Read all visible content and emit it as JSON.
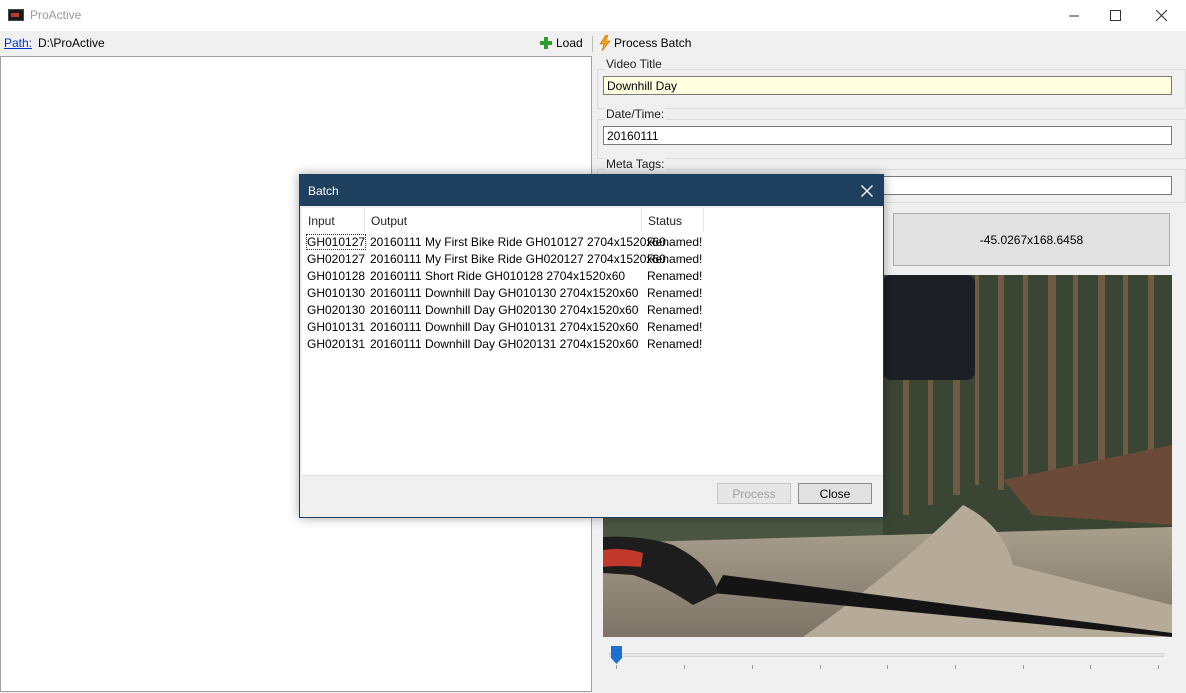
{
  "window": {
    "title": "ProActive",
    "controls": [
      "minimize-icon",
      "maximize-icon",
      "close-icon"
    ]
  },
  "toolbar": {
    "path_label": "Path:",
    "path_value": "D:\\ProActive",
    "load_label": "Load",
    "process_batch_label": "Process Batch",
    "icons": [
      "plus-icon",
      "lightning-icon"
    ]
  },
  "details": {
    "video_title_label": "Video Title",
    "video_title_value": "Downhill Day",
    "datetime_label": "Date/Time:",
    "datetime_value": "20160111",
    "meta_tags_label": "Meta Tags:",
    "meta_tags_value": "",
    "coordinates": "-45.0267x168.6458"
  },
  "batch_dialog": {
    "title": "Batch",
    "columns": [
      "Input",
      "Output",
      "Status"
    ],
    "rows": [
      {
        "input": "GH010127",
        "output": "20160111 My First Bike Ride GH010127 2704x1520x60",
        "status": "Renamed!"
      },
      {
        "input": "GH020127",
        "output": "20160111 My First Bike Ride GH020127 2704x1520x60",
        "status": "Renamed!"
      },
      {
        "input": "GH010128",
        "output": "20160111 Short Ride GH010128 2704x1520x60",
        "status": "Renamed!"
      },
      {
        "input": "GH010130",
        "output": "20160111 Downhill Day GH010130 2704x1520x60",
        "status": "Renamed!"
      },
      {
        "input": "GH020130",
        "output": "20160111 Downhill Day GH020130 2704x1520x60",
        "status": "Renamed!"
      },
      {
        "input": "GH010131",
        "output": "20160111 Downhill Day GH010131 2704x1520x60",
        "status": "Renamed!"
      },
      {
        "input": "GH020131",
        "output": "20160111 Downhill Day GH020131 2704x1520x60",
        "status": "Renamed!"
      }
    ],
    "process_label": "Process",
    "close_label": "Close"
  },
  "colors": {
    "dialog_titlebar": "#1e3f5e",
    "title_field_bg": "#ffffe1",
    "trackbar_thumb": "#1f6fd0"
  },
  "trackbar": {
    "position": 0
  }
}
